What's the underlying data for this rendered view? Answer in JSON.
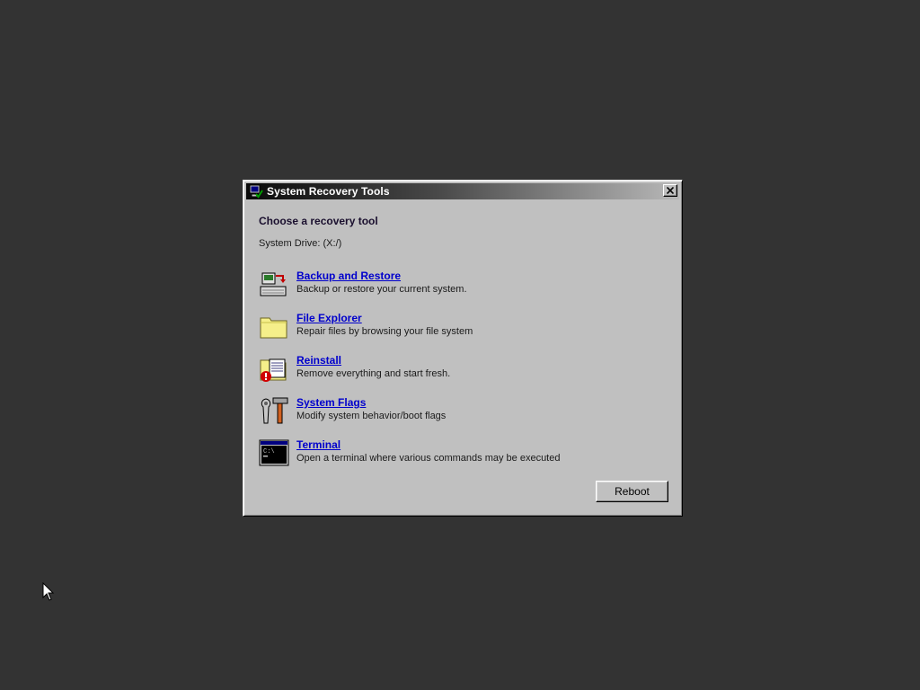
{
  "window": {
    "title": "System Recovery Tools",
    "title_icon": "computer-check-icon",
    "close_icon": "close-icon"
  },
  "main": {
    "heading": "Choose a recovery tool",
    "system_drive": "System Drive: (X:/)"
  },
  "tools": [
    {
      "label": "Backup and Restore",
      "description": "Backup or restore your current system.",
      "icon": "backup-restore-icon"
    },
    {
      "label": "File Explorer",
      "description": "Repair files by browsing your file system",
      "icon": "folder-icon"
    },
    {
      "label": "Reinstall",
      "description": "Remove everything and start fresh.",
      "icon": "reinstall-icon"
    },
    {
      "label": "System Flags",
      "description": "Modify system behavior/boot flags",
      "icon": "tools-icon"
    },
    {
      "label": "Terminal",
      "description": "Open a terminal where various commands may be executed",
      "icon": "terminal-icon"
    }
  ],
  "buttons": {
    "reboot_label": "Reboot"
  },
  "colors": {
    "desktop": "#333333",
    "window": "#c0c0c0",
    "link": "#0000cc"
  }
}
